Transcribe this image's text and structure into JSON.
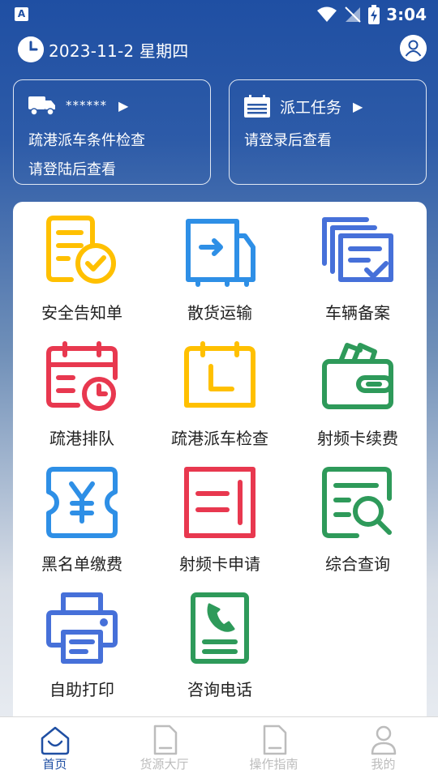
{
  "status_bar": {
    "time": "3:04",
    "app_badge": "A"
  },
  "header": {
    "date": "2023-11-2 星期四"
  },
  "cards": {
    "left": {
      "masked": "******",
      "line1": "疏港派车条件检查",
      "line2": "请登陆后查看"
    },
    "right": {
      "title": "派工任务",
      "line1": "请登录后查看"
    }
  },
  "grid": [
    {
      "label": "安全告知单",
      "color": "#FFC000"
    },
    {
      "label": "散货运输",
      "color": "#2E8FE6"
    },
    {
      "label": "车辆备案",
      "color": "#4670D9"
    },
    {
      "label": "疏港排队",
      "color": "#E8384F"
    },
    {
      "label": "疏港派车检查",
      "color": "#FFC000"
    },
    {
      "label": "射频卡续费",
      "color": "#2E9A5A"
    },
    {
      "label": "黑名单缴费",
      "color": "#2E8FE6"
    },
    {
      "label": "射频卡申请",
      "color": "#E8384F"
    },
    {
      "label": "综合查询",
      "color": "#2E9A5A"
    },
    {
      "label": "自助打印",
      "color": "#4670D9"
    },
    {
      "label": "咨询电话",
      "color": "#2E9A5A"
    }
  ],
  "tabs": [
    {
      "label": "首页",
      "active": true
    },
    {
      "label": "货源大厅",
      "active": false
    },
    {
      "label": "操作指南",
      "active": false
    },
    {
      "label": "我的",
      "active": false
    }
  ],
  "colors": {
    "brand": "#1F4FA3",
    "tab_inactive": "#BCBCBC"
  }
}
